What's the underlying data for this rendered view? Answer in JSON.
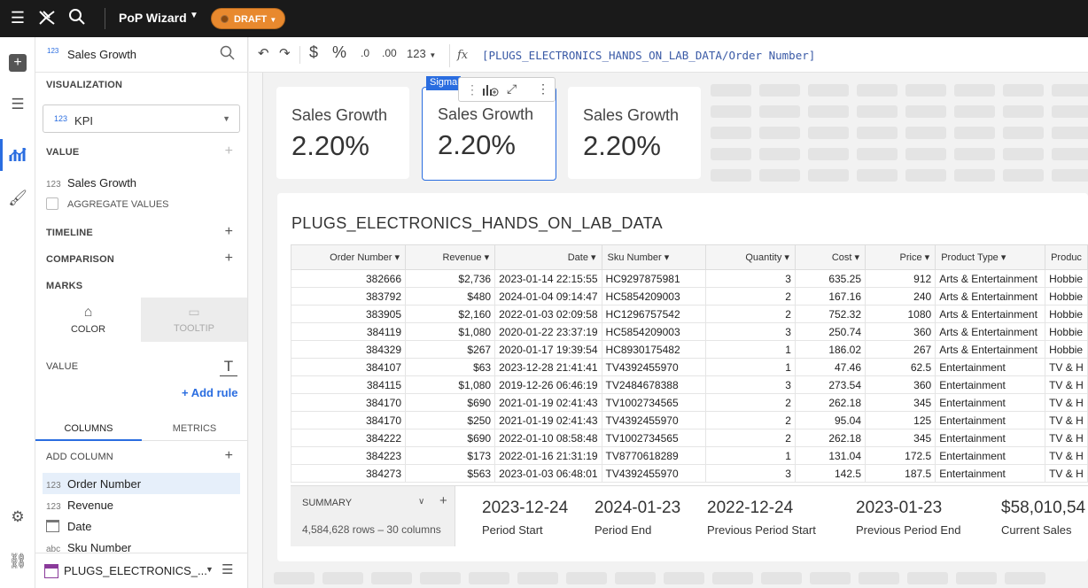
{
  "topbar": {
    "workbook_title": "PoP Wizard",
    "status_label": "DRAFT"
  },
  "panel": {
    "element_title": "Sales Growth",
    "element_type_badge": "123",
    "visualization_label": "VISUALIZATION",
    "viz_type": "KPI",
    "viz_badge": "123",
    "value_label": "VALUE",
    "value_field": "Sales Growth",
    "value_field_type": "123",
    "aggregate_label": "AGGREGATE VALUES",
    "timeline_label": "TIMELINE",
    "comparison_label": "COMPARISON",
    "marks_label": "MARKS",
    "color_label": "COLOR",
    "tooltip_label": "TOOLTIP",
    "marks_value_label": "VALUE",
    "add_rule_label": "+ Add rule",
    "tab_columns": "COLUMNS",
    "tab_metrics": "METRICS",
    "add_column_label": "ADD COLUMN",
    "columns": [
      {
        "type": "123",
        "name": "Order Number"
      },
      {
        "type": "123",
        "name": "Revenue"
      },
      {
        "type": "cal",
        "name": "Date"
      },
      {
        "type": "abc",
        "name": "Sku Number"
      }
    ],
    "source_name": "PLUGS_ELECTRONICS_..."
  },
  "formula": {
    "fx": "fx",
    "format_number": "123",
    "expression": "[PLUGS_ELECTRONICS_HANDS_ON_LAB_DATA/Order Number]"
  },
  "kpis": [
    {
      "title": "Sales Growth",
      "value": "2.20%"
    },
    {
      "title": "Sales Growth",
      "value": "2.20%"
    },
    {
      "title": "Sales Growth",
      "value": "2.20%"
    }
  ],
  "selected_tag": "Sigma",
  "table": {
    "title": "PLUGS_ELECTRONICS_HANDS_ON_LAB_DATA",
    "headers": [
      "Order Number",
      "Revenue",
      "Date",
      "Sku Number",
      "Quantity",
      "Cost",
      "Price",
      "Product Type",
      "Produc"
    ],
    "rows": [
      [
        "382666",
        "$2,736",
        "2023-01-14 22:15:55",
        "HC9297875981",
        "3",
        "635.25",
        "912",
        "Arts & Entertainment",
        "Hobbie"
      ],
      [
        "383792",
        "$480",
        "2024-01-04 09:14:47",
        "HC5854209003",
        "2",
        "167.16",
        "240",
        "Arts & Entertainment",
        "Hobbie"
      ],
      [
        "383905",
        "$2,160",
        "2022-01-03 02:09:58",
        "HC1296757542",
        "2",
        "752.32",
        "1080",
        "Arts & Entertainment",
        "Hobbie"
      ],
      [
        "384119",
        "$1,080",
        "2020-01-22 23:37:19",
        "HC5854209003",
        "3",
        "250.74",
        "360",
        "Arts & Entertainment",
        "Hobbie"
      ],
      [
        "384329",
        "$267",
        "2020-01-17 19:39:54",
        "HC8930175482",
        "1",
        "186.02",
        "267",
        "Arts & Entertainment",
        "Hobbie"
      ],
      [
        "384107",
        "$63",
        "2023-12-28 21:41:41",
        "TV4392455970",
        "1",
        "47.46",
        "62.5",
        "Entertainment",
        "TV & H"
      ],
      [
        "384115",
        "$1,080",
        "2019-12-26 06:46:19",
        "TV2484678388",
        "3",
        "273.54",
        "360",
        "Entertainment",
        "TV & H"
      ],
      [
        "384170",
        "$690",
        "2021-01-19 02:41:43",
        "TV1002734565",
        "2",
        "262.18",
        "345",
        "Entertainment",
        "TV & H"
      ],
      [
        "384170",
        "$250",
        "2021-01-19 02:41:43",
        "TV4392455970",
        "2",
        "95.04",
        "125",
        "Entertainment",
        "TV & H"
      ],
      [
        "384222",
        "$690",
        "2022-01-10 08:58:48",
        "TV1002734565",
        "2",
        "262.18",
        "345",
        "Entertainment",
        "TV & H"
      ],
      [
        "384223",
        "$173",
        "2022-01-16 21:31:19",
        "TV8770618289",
        "1",
        "131.04",
        "172.5",
        "Entertainment",
        "TV & H"
      ],
      [
        "384273",
        "$563",
        "2023-01-03 06:48:01",
        "TV4392455970",
        "3",
        "142.5",
        "187.5",
        "Entertainment",
        "TV & H"
      ]
    ]
  },
  "summary": {
    "label": "SUMMARY",
    "rows_info": "4,584,628 rows – 30 columns",
    "items": [
      {
        "value": "2023-12-24",
        "label": "Period Start"
      },
      {
        "value": "2024-01-23",
        "label": "Period End"
      },
      {
        "value": "2022-12-24",
        "label": "Previous Period Start"
      },
      {
        "value": "2023-01-23",
        "label": "Previous Period End"
      },
      {
        "value": "$58,010,54",
        "label": "Current Sales"
      }
    ]
  },
  "colors": {
    "accent": "#2a6de0",
    "draft": "#e8892e",
    "topbar": "#1a1a1a"
  }
}
